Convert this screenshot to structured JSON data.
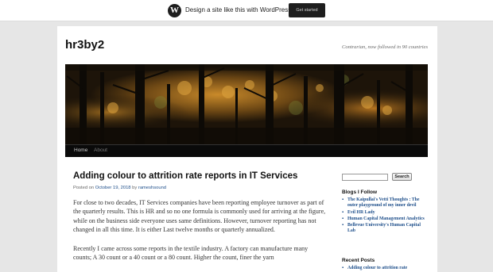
{
  "wpbar": {
    "logo_glyph": "W",
    "text": "Design a site like this with WordPress.com",
    "button_label": "Get started"
  },
  "site": {
    "title": "hr3by2",
    "description": "Contrarian, now followed in 90 countries"
  },
  "nav": {
    "items": [
      {
        "label": "Home"
      },
      {
        "label": "About"
      }
    ]
  },
  "post": {
    "title": "Adding colour to attrition rate reports in IT Services",
    "meta": {
      "posted_on": "Posted on",
      "date": "October 19, 2018",
      "by": "by",
      "author": "rameshsound"
    },
    "paragraphs": [
      "For close to two decades, IT Services companies have been reporting employee turnover as part of the quarterly results. This is HR and so no one formula is commonly used for arriving at the figure, while on the business side everyone uses same definitions. However, turnover reporting has not changed in all this time. It is either Last twelve months or quarterly annualized.",
      "Recently I came across some reports in the textile industry. A factory can manufacture many counts; A 30 count or a 40 count or a 80 count. Higher the count, finer the yarn"
    ]
  },
  "sidebar": {
    "search_button": "Search",
    "search_value": "",
    "blogs_heading": "Blogs I Follow",
    "blogs": [
      "The Kaipullai's Vetti Thoughts : The outer playground of my inner devil",
      "Evil HR Lady",
      "Human Capital Management Analytics",
      "Bellevue University's Human Capital Lab"
    ],
    "recent_heading": "Recent Posts",
    "recent": [
      "Adding colour to attrition rate"
    ]
  },
  "colors": {
    "link": "#1d4e8a",
    "nav_bg": "#0a0a0a",
    "page_bg": "#e6e6e6"
  }
}
